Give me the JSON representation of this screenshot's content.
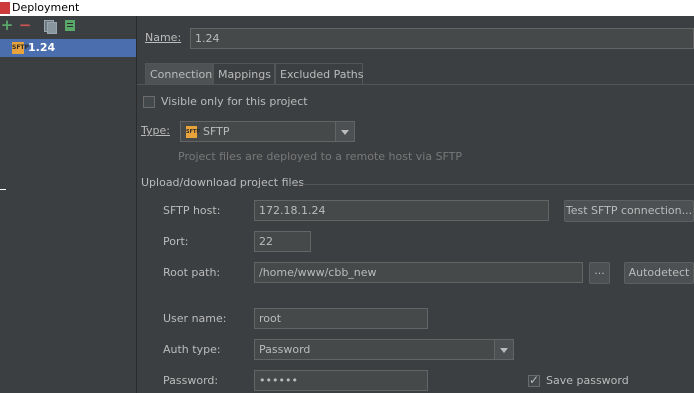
{
  "window": {
    "title": "Deployment"
  },
  "toolbar": {
    "add_label": "+",
    "remove_label": "−"
  },
  "servers": [
    {
      "name": "1.24",
      "icon_text": "SFTP",
      "selected": true
    }
  ],
  "name_field": {
    "label": "Name:",
    "value": "1.24"
  },
  "tabs": [
    {
      "label": "Connection",
      "active": true
    },
    {
      "label": "Mappings"
    },
    {
      "label": "Excluded Paths"
    }
  ],
  "connection": {
    "visible_only": {
      "label": "Visible only for this project",
      "checked": false
    },
    "type": {
      "label": "Type:",
      "value": "SFTP",
      "icon_text": "SFTP",
      "hint": "Project files are deployed to a remote host via SFTP"
    },
    "section_title": "Upload/download project files",
    "sftp_host": {
      "label": "SFTP host:",
      "value": "172.18.1.24",
      "test_button": "Test SFTP connection..."
    },
    "port": {
      "label": "Port:",
      "value": "22"
    },
    "root_path": {
      "label": "Root path:",
      "value": "/home/www/cbb_new",
      "browse_button": "...",
      "autodetect_button": "Autodetect"
    },
    "user_name": {
      "label": "User name:",
      "value": "root"
    },
    "auth_type": {
      "label": "Auth type:",
      "value": "Password"
    },
    "password": {
      "label": "Password:",
      "value": "••••••"
    },
    "save_password": {
      "label": "Save password",
      "checked": true
    }
  },
  "colors": {
    "selection": "#4b6eaf",
    "add": "#59a869",
    "remove": "#c75450",
    "background": "#3c3f41"
  }
}
